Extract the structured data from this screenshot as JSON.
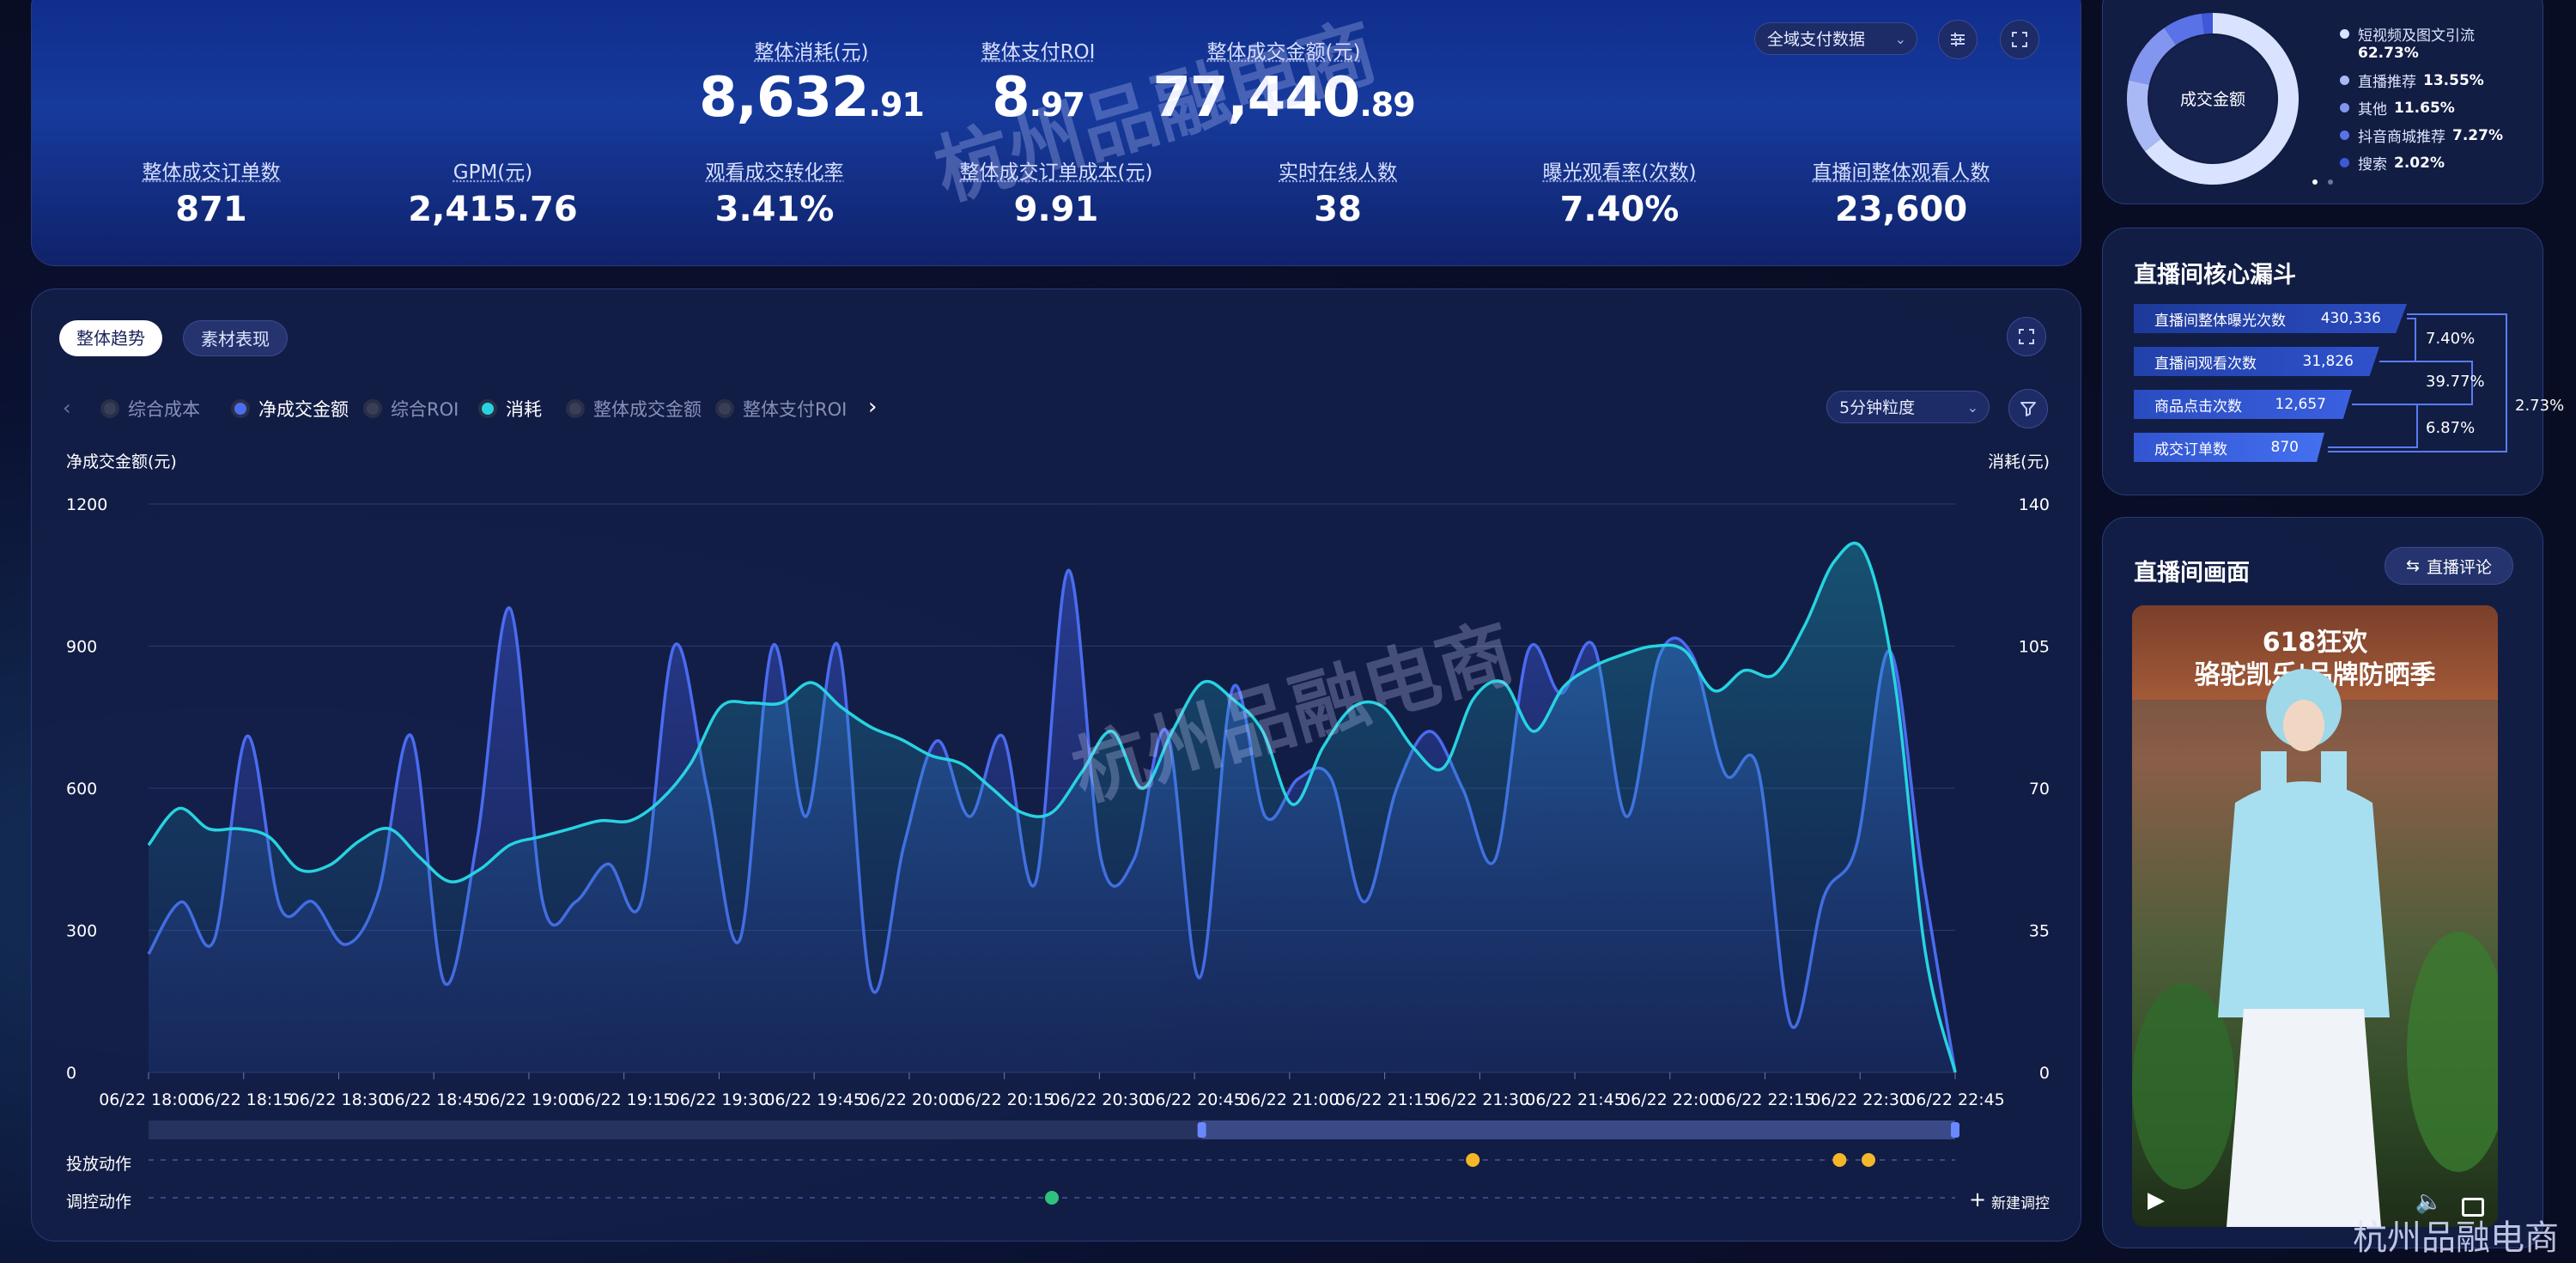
{
  "top": {
    "big_metrics": [
      {
        "label": "整体消耗(元)",
        "int": "8,632",
        "dec": ".91"
      },
      {
        "label": "整体支付ROI",
        "int": "8",
        "dec": ".97"
      },
      {
        "label": "整体成交金额(元)",
        "int": "77,440",
        "dec": ".89"
      }
    ],
    "metrics": [
      {
        "label": "整体成交订单数",
        "value": "871"
      },
      {
        "label": "GPM(元)",
        "value": "2,415.76"
      },
      {
        "label": "观看成交转化率",
        "value": "3.41%"
      },
      {
        "label": "整体成交订单成本(元)",
        "value": "9.91"
      },
      {
        "label": "实时在线人数",
        "value": "38"
      },
      {
        "label": "曝光观看率(次数)",
        "value": "7.40%"
      },
      {
        "label": "直播间整体观看人数",
        "value": "23,600"
      }
    ],
    "data_select": "全域支付数据"
  },
  "chart_card": {
    "tabs": [
      "整体趋势",
      "素材表现"
    ],
    "legend": [
      {
        "label": "综合成本",
        "on": false,
        "color": "#3a3f58"
      },
      {
        "label": "净成交金额",
        "on": true,
        "color": "#4a6cf0"
      },
      {
        "label": "综合ROI",
        "on": false,
        "color": "#3a3f58"
      },
      {
        "label": "消耗",
        "on": true,
        "color": "#27d3e0"
      },
      {
        "label": "整体成交金额",
        "on": false,
        "color": "#3a3f58"
      },
      {
        "label": "整体支付ROI",
        "on": false,
        "color": "#3a3f58"
      }
    ],
    "granularity": "5分钟粒度",
    "action_rows": [
      "投放动作",
      "调控动作"
    ],
    "new_control": "新建调控"
  },
  "chart_data": {
    "type": "line",
    "ylabel": "净成交金额(元)",
    "y2label": "消耗(元)",
    "ylim": [
      0,
      1200
    ],
    "y2lim": [
      0,
      140
    ],
    "yticks": [
      "1200",
      "900",
      "600",
      "300",
      "0"
    ],
    "y2ticks": [
      "140",
      "105",
      "70",
      "35",
      "0"
    ],
    "xticks": [
      "06/22 18:00",
      "06/22 18:15",
      "06/22 18:30",
      "06/22 18:45",
      "06/22 19:00",
      "06/22 19:15",
      "06/22 19:30",
      "06/22 19:45",
      "06/22 20:00",
      "06/22 20:15",
      "06/22 20:30",
      "06/22 20:45",
      "06/22 21:00",
      "06/22 21:15",
      "06/22 21:30",
      "06/22 21:45",
      "06/22 22:00",
      "06/22 22:15",
      "06/22 22:30",
      "06/22 22:45"
    ],
    "series": [
      {
        "name": "净成交金额",
        "color": "#4a6cf0",
        "axis": "left",
        "values": [
          250,
          360,
          280,
          710,
          350,
          360,
          270,
          380,
          710,
          190,
          490,
          980,
          360,
          360,
          440,
          360,
          900,
          600,
          280,
          900,
          540,
          900,
          180,
          480,
          700,
          540,
          710,
          400,
          1060,
          450,
          450,
          720,
          200,
          810,
          540,
          620,
          620,
          360,
          600,
          720,
          600,
          450,
          890,
          800,
          900,
          540,
          880,
          880,
          630,
          640,
          100,
          370,
          480,
          890,
          420,
          0
        ]
      },
      {
        "name": "消耗",
        "color": "#27d3e0",
        "axis": "right",
        "values": [
          56,
          65,
          60,
          60,
          58,
          50,
          51,
          57,
          60,
          53,
          47,
          50,
          56,
          58,
          60,
          62,
          62,
          67,
          76,
          90,
          91,
          91,
          96,
          90,
          85,
          82,
          78,
          76,
          70,
          64,
          64,
          74,
          84,
          70,
          84,
          96,
          92,
          84,
          66,
          80,
          90,
          90,
          80,
          75,
          92,
          96,
          84,
          95,
          100,
          103,
          105,
          104,
          94,
          99,
          98,
          110,
          126,
          128,
          96,
          30,
          0
        ]
      }
    ],
    "dispatch_dots": [
      {
        "row": 0,
        "x": 0.733
      },
      {
        "row": 0,
        "x": 0.936
      },
      {
        "row": 0,
        "x": 0.952
      },
      {
        "row": 1,
        "x": 0.5
      }
    ]
  },
  "pie_card": {
    "center_label": "成交金额",
    "items": [
      {
        "label": "短视频及图文引流",
        "value": "62.73%",
        "color": "#d9e2ff",
        "pct": 62.73
      },
      {
        "label": "直播推荐",
        "value": "13.55%",
        "color": "#a9b9f5",
        "pct": 13.55
      },
      {
        "label": "其他",
        "value": "11.65%",
        "color": "#8296ef",
        "pct": 11.65
      },
      {
        "label": "抖音商城推荐",
        "value": "7.27%",
        "color": "#5a72e8",
        "pct": 7.27
      },
      {
        "label": "搜索",
        "value": "2.02%",
        "color": "#3e58d8",
        "pct": 2.02
      }
    ]
  },
  "funnel_card": {
    "title": "直播间核心漏斗",
    "stages": [
      {
        "label": "直播间整体曝光次数",
        "value": "430,336"
      },
      {
        "label": "直播间观看次数",
        "value": "31,826"
      },
      {
        "label": "商品点击次数",
        "value": "12,657"
      },
      {
        "label": "成交订单数",
        "value": "870"
      }
    ],
    "rates": [
      "7.40%",
      "39.77%",
      "6.87%",
      "2.73%"
    ]
  },
  "video_card": {
    "title": "直播间画面",
    "comment_btn": "直播评论",
    "banner_line1": "618狂欢",
    "banner_line2": "骆驼凯乐|品牌防晒季"
  },
  "watermark": "杭州品融电商"
}
